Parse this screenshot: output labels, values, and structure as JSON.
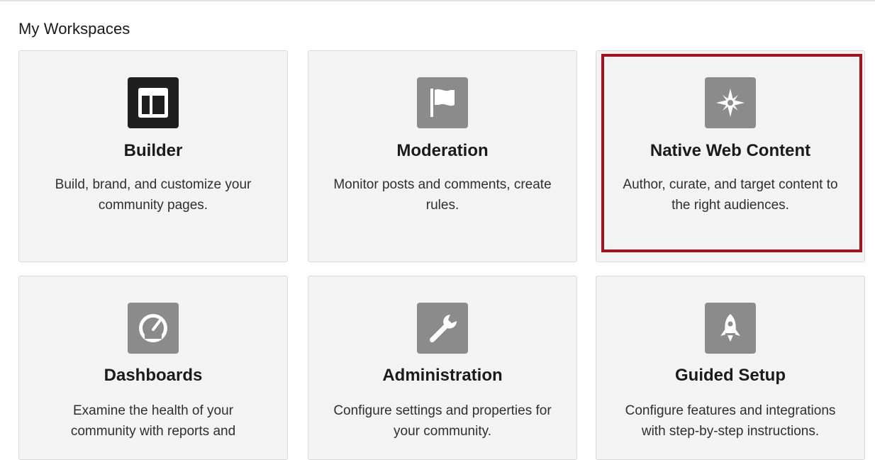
{
  "page": {
    "title": "My Workspaces"
  },
  "cards": [
    {
      "title": "Builder",
      "description": "Build, brand, and customize your community pages.",
      "icon": "builder-layout-icon"
    },
    {
      "title": "Moderation",
      "description": "Monitor posts and comments, create rules.",
      "icon": "flag-icon"
    },
    {
      "title": "Native Web Content",
      "description": "Author, curate, and target content to the right audiences.",
      "icon": "compass-icon"
    },
    {
      "title": "Dashboards",
      "description": "Examine the health of your community with reports and",
      "icon": "gauge-icon"
    },
    {
      "title": "Administration",
      "description": "Configure settings and properties for your community.",
      "icon": "wrench-icon"
    },
    {
      "title": "Guided Setup",
      "description": "Configure features and integrations with step-by-step instructions.",
      "icon": "rocket-icon"
    }
  ],
  "colors": {
    "highlight": "#a4101c",
    "card_bg": "#f3f3f3",
    "icon_bg": "#8b8b8b",
    "icon_bg_dark": "#1f1f1f"
  }
}
